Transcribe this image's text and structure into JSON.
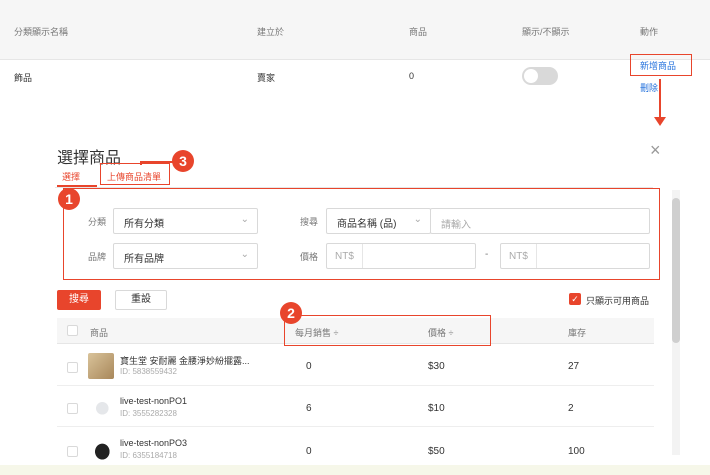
{
  "top_table": {
    "headers": [
      "分類顯示名稱",
      "建立於",
      "商品",
      "顯示/不顯示",
      "動作"
    ],
    "row": {
      "name": "飾品",
      "created_by": "賣家",
      "count": "0",
      "actions": [
        "新增商品",
        "刪除"
      ]
    }
  },
  "modal": {
    "title": "選擇商品",
    "tabs": [
      "選擇",
      "上傳商品清單"
    ],
    "filters": {
      "category_label": "分類",
      "category_value": "所有分類",
      "brand_label": "品牌",
      "brand_value": "所有品牌",
      "search_label": "搜尋",
      "search_field_value": "商品名稱 (品)",
      "search_placeholder": "請輸入",
      "price_label": "價格",
      "price_prefix": "NT$",
      "price_sep": "-"
    },
    "search_button": "搜尋",
    "reset_button": "重設",
    "only_available_label": "只顯示可用商品",
    "table_headers": [
      "商品",
      "每月銷售 ÷",
      "價格 ÷",
      "庫存"
    ],
    "rows": [
      {
        "name": "寶生堂 安耐麗 金腰淨妙紛擺露...",
        "id": "ID: 5838559432",
        "sales": "0",
        "price": "$30",
        "stock": "27"
      },
      {
        "name": "live-test-nonPO1",
        "id": "ID: 3555282328",
        "sales": "6",
        "price": "$10",
        "stock": "2"
      },
      {
        "name": "live-test-nonPO3",
        "id": "ID: 6355184718",
        "sales": "0",
        "price": "$50",
        "stock": "100"
      }
    ]
  },
  "badges": [
    "1",
    "2",
    "3"
  ],
  "colors": {
    "accent": "#e8452c",
    "link": "#2673dd"
  },
  "icons": [
    "close-icon",
    "chevron-down-icon",
    "checkbox-checked-icon",
    "arrow-down-icon"
  ]
}
